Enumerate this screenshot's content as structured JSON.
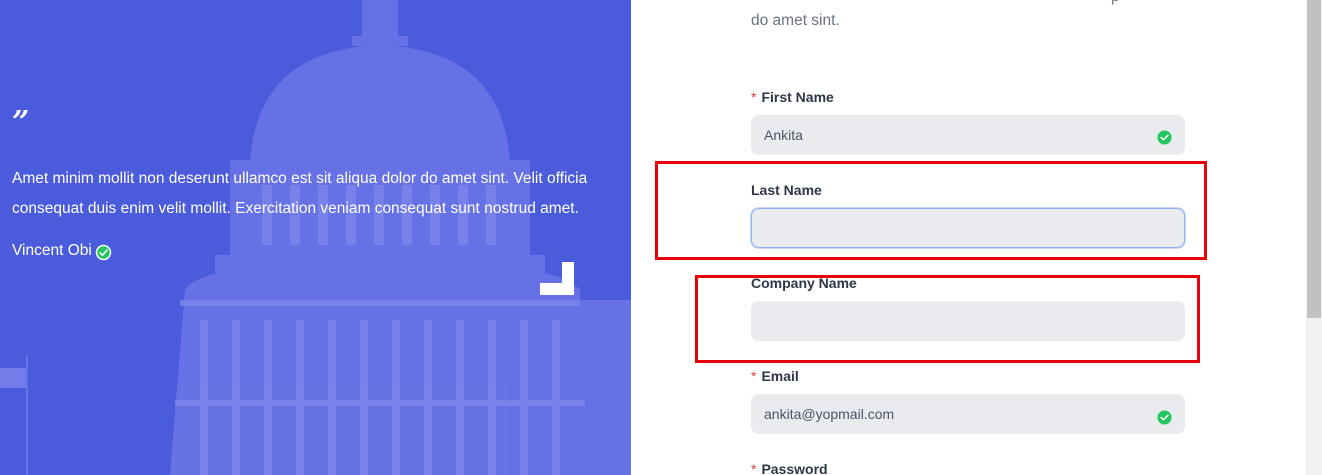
{
  "testimonial": {
    "quote_mark": "”",
    "text": "Amet minim mollit non deserunt ullamco est sit aliqua dolor do amet sint. Velit officia consequat duis enim velit mollit. Exercitation veniam consequat sunt nostrud amet.",
    "author": "Vincent Obi"
  },
  "intro": {
    "text": "do amet sint.",
    "tail": "p"
  },
  "form": {
    "first_name": {
      "label": "First Name",
      "required_mark": "*",
      "value": "Ankita"
    },
    "last_name": {
      "label": "Last Name",
      "value": ""
    },
    "company_name": {
      "label": "Company Name",
      "value": ""
    },
    "email": {
      "label": "Email",
      "required_mark": "*",
      "value": "ankita@yopmail.com"
    },
    "password": {
      "label": "Password",
      "required_mark": "*"
    }
  },
  "colors": {
    "panel_blue": "#4a5bdc",
    "valid_green": "#22c55e",
    "highlight_red": "#e8000b"
  }
}
